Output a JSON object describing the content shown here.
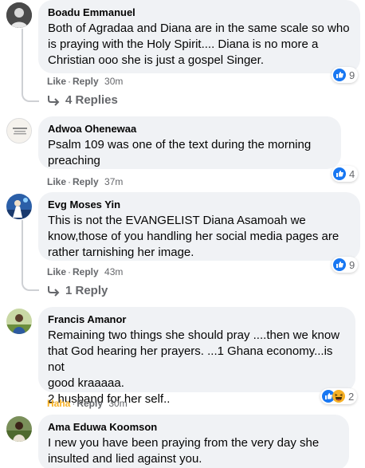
{
  "comments": [
    {
      "author": "Boadu Emmanuel",
      "text": "Both of Agradaa and Diana are in the same scale so who is praying with the Holy Spirit.... Diana is no more a Christian ooo she is just a gospel Singer.",
      "like": "Like",
      "reply": "Reply",
      "time": "30m",
      "reaction_count": "9",
      "replies": "4 Replies"
    },
    {
      "author": "Adwoa Ohenewaa",
      "text": "Psalm 109 was one of the text during the morning preaching",
      "like": "Like",
      "reply": "Reply",
      "time": "37m",
      "reaction_count": "4"
    },
    {
      "author": "Evg Moses Yin",
      "text": "This is not the EVANGELIST Diana Asamoah we know,those of you handling her social media pages are rather tarnishing her image.",
      "like": "Like",
      "reply": "Reply",
      "time": "43m",
      "reaction_count": "9",
      "replies": "1 Reply"
    },
    {
      "author": "Francis Amanor",
      "text_lines": [
        "Remaining two things she should pray ....then we know",
        "that God hearing her prayers. ...1 Ghana economy...is not",
        "good kraaaaa.",
        "2 husband for her self.."
      ],
      "like": "Haha",
      "reply": "Reply",
      "time": "30m",
      "reaction_count": "2"
    },
    {
      "author": "Ama Eduwa Koomson",
      "text": "I new you have been praying from the very day she insulted and lied against you."
    }
  ],
  "colors": {
    "bubble": "#f0f2f5",
    "meta": "#65676b",
    "like_blue": "#1877f2",
    "haha_yellow": "#f7b125"
  },
  "icons": [
    "like-reaction-icon",
    "haha-reaction-icon",
    "reply-arrow-icon"
  ]
}
